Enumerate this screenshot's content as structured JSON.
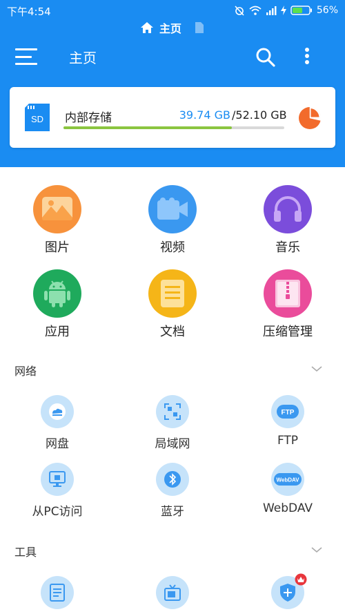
{
  "status": {
    "time": "下午4:54",
    "battery": "56%"
  },
  "breadcrumb": {
    "label": "主页"
  },
  "toolbar": {
    "title": "主页"
  },
  "storage": {
    "sd_label": "SD",
    "name": "内部存储",
    "used": "39.74 GB",
    "total": "/52.10 GB",
    "used_fraction": 0.763
  },
  "categories": [
    {
      "label": "图片",
      "color": "#f7923c"
    },
    {
      "label": "视频",
      "color": "#3a98f0"
    },
    {
      "label": "音乐",
      "color": "#7b4ddb"
    },
    {
      "label": "应用",
      "color": "#1faa5c"
    },
    {
      "label": "文档",
      "color": "#f5b518"
    },
    {
      "label": "压缩管理",
      "color": "#ea4c9b"
    }
  ],
  "network": {
    "title": "网络",
    "items": [
      {
        "label": "网盘"
      },
      {
        "label": "局域网"
      },
      {
        "label": "FTP",
        "badge": "FTP"
      },
      {
        "label": "从PC访问"
      },
      {
        "label": "蓝牙"
      },
      {
        "label": "WebDAV",
        "badge": "WebDAV"
      }
    ]
  },
  "tools": {
    "title": "工具"
  },
  "colors": {
    "primary": "#1a8cf2",
    "accent_green": "#8bc540",
    "pie_orange": "#f26b2c",
    "light_blue": "#c6e3fa"
  }
}
